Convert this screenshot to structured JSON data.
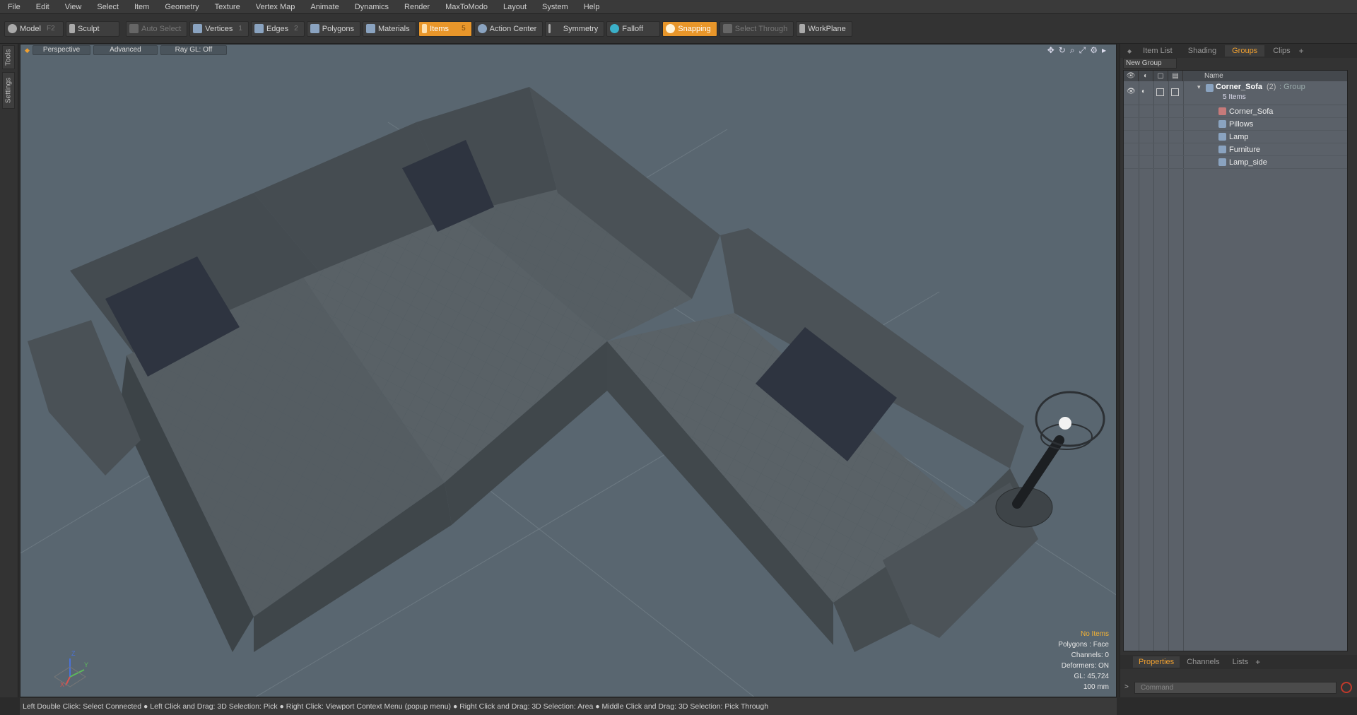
{
  "menu": [
    "File",
    "Edit",
    "View",
    "Select",
    "Item",
    "Geometry",
    "Texture",
    "Vertex Map",
    "Animate",
    "Dynamics",
    "Render",
    "MaxToModo",
    "Layout",
    "System",
    "Help"
  ],
  "toolbar": {
    "model": "Model",
    "model_key": "F2",
    "sculpt": "Sculpt",
    "auto_select": "Auto Select",
    "vertices": "Vertices",
    "vertices_num": "1",
    "edges": "Edges",
    "edges_num": "2",
    "polygons": "Polygons",
    "materials": "Materials",
    "items": "Items",
    "items_num": "5",
    "action_center": "Action Center",
    "symmetry": "Symmetry",
    "falloff": "Falloff",
    "snapping": "Snapping",
    "select_through": "Select Through",
    "workplane": "WorkPlane"
  },
  "left_tabs": [
    "Tools",
    "Settings"
  ],
  "viewport": {
    "perspective": "Perspective",
    "advanced": "Advanced",
    "raygl": "Ray GL: Off",
    "hud": {
      "no_items": "No Items",
      "polygons": "Polygons : Face",
      "channels": "Channels: 0",
      "deformers": "Deformers: ON",
      "gl": "GL: 45,724",
      "unit": "100 mm"
    },
    "axis_z": "Z",
    "axis_y": "Y",
    "axis_x": "X"
  },
  "status": "Left Double Click: Select Connected ● Left Click and Drag: 3D Selection: Pick ● Right Click: Viewport Context Menu (popup menu) ● Right Click and Drag: 3D Selection: Area ● Middle Click and Drag: 3D Selection: Pick Through",
  "right_panel": {
    "tabs": [
      "Item List",
      "Shading",
      "Groups",
      "Clips"
    ],
    "active_tab": "Groups",
    "new_group": "New Group",
    "col_name": "Name",
    "group": {
      "name": "Corner_Sofa",
      "count": "(2)",
      "type": ": Group",
      "sub": "5 Items"
    },
    "items": [
      "Corner_Sofa",
      "Pillows",
      "Lamp",
      "Furniture",
      "Lamp_side"
    ]
  },
  "bottom_panel": {
    "tabs": [
      "Properties",
      "Channels",
      "Lists"
    ],
    "command_placeholder": "Command"
  },
  "colors": {
    "accent": "#e8962a",
    "viewport_bg": "#596670"
  }
}
